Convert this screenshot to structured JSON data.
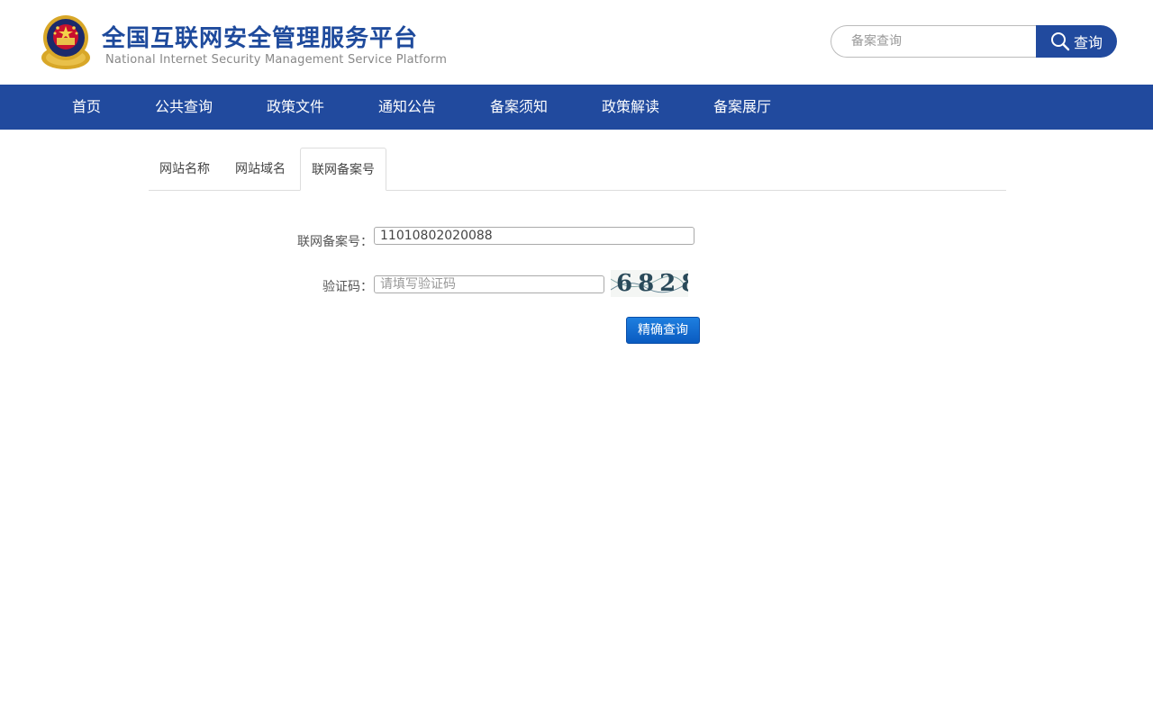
{
  "header": {
    "title": "全国互联网安全管理服务平台",
    "subtitle": "National Internet Security Management Service Platform",
    "logo_icon": "police-emblem-icon"
  },
  "search": {
    "placeholder": "备案查询",
    "button_label": "查询",
    "icon": "search-icon"
  },
  "nav": {
    "items": [
      {
        "label": "首页"
      },
      {
        "label": "公共查询"
      },
      {
        "label": "政策文件"
      },
      {
        "label": "通知公告"
      },
      {
        "label": "备案须知"
      },
      {
        "label": "政策解读"
      },
      {
        "label": "备案展厅"
      }
    ]
  },
  "tabs": {
    "items": [
      {
        "label": "网站名称"
      },
      {
        "label": "网站域名"
      },
      {
        "label": "联网备案号"
      }
    ],
    "active_index": 2
  },
  "form": {
    "record_label": "联网备案号：",
    "record_value": "11010802020088",
    "captcha_label": "验证码：",
    "captcha_placeholder": "请填写验证码",
    "captcha_text": "6828",
    "submit_label": "精确查询"
  },
  "colors": {
    "brand": "#214a9e",
    "title": "#1e4a9c",
    "button": "#0a5bc0"
  }
}
